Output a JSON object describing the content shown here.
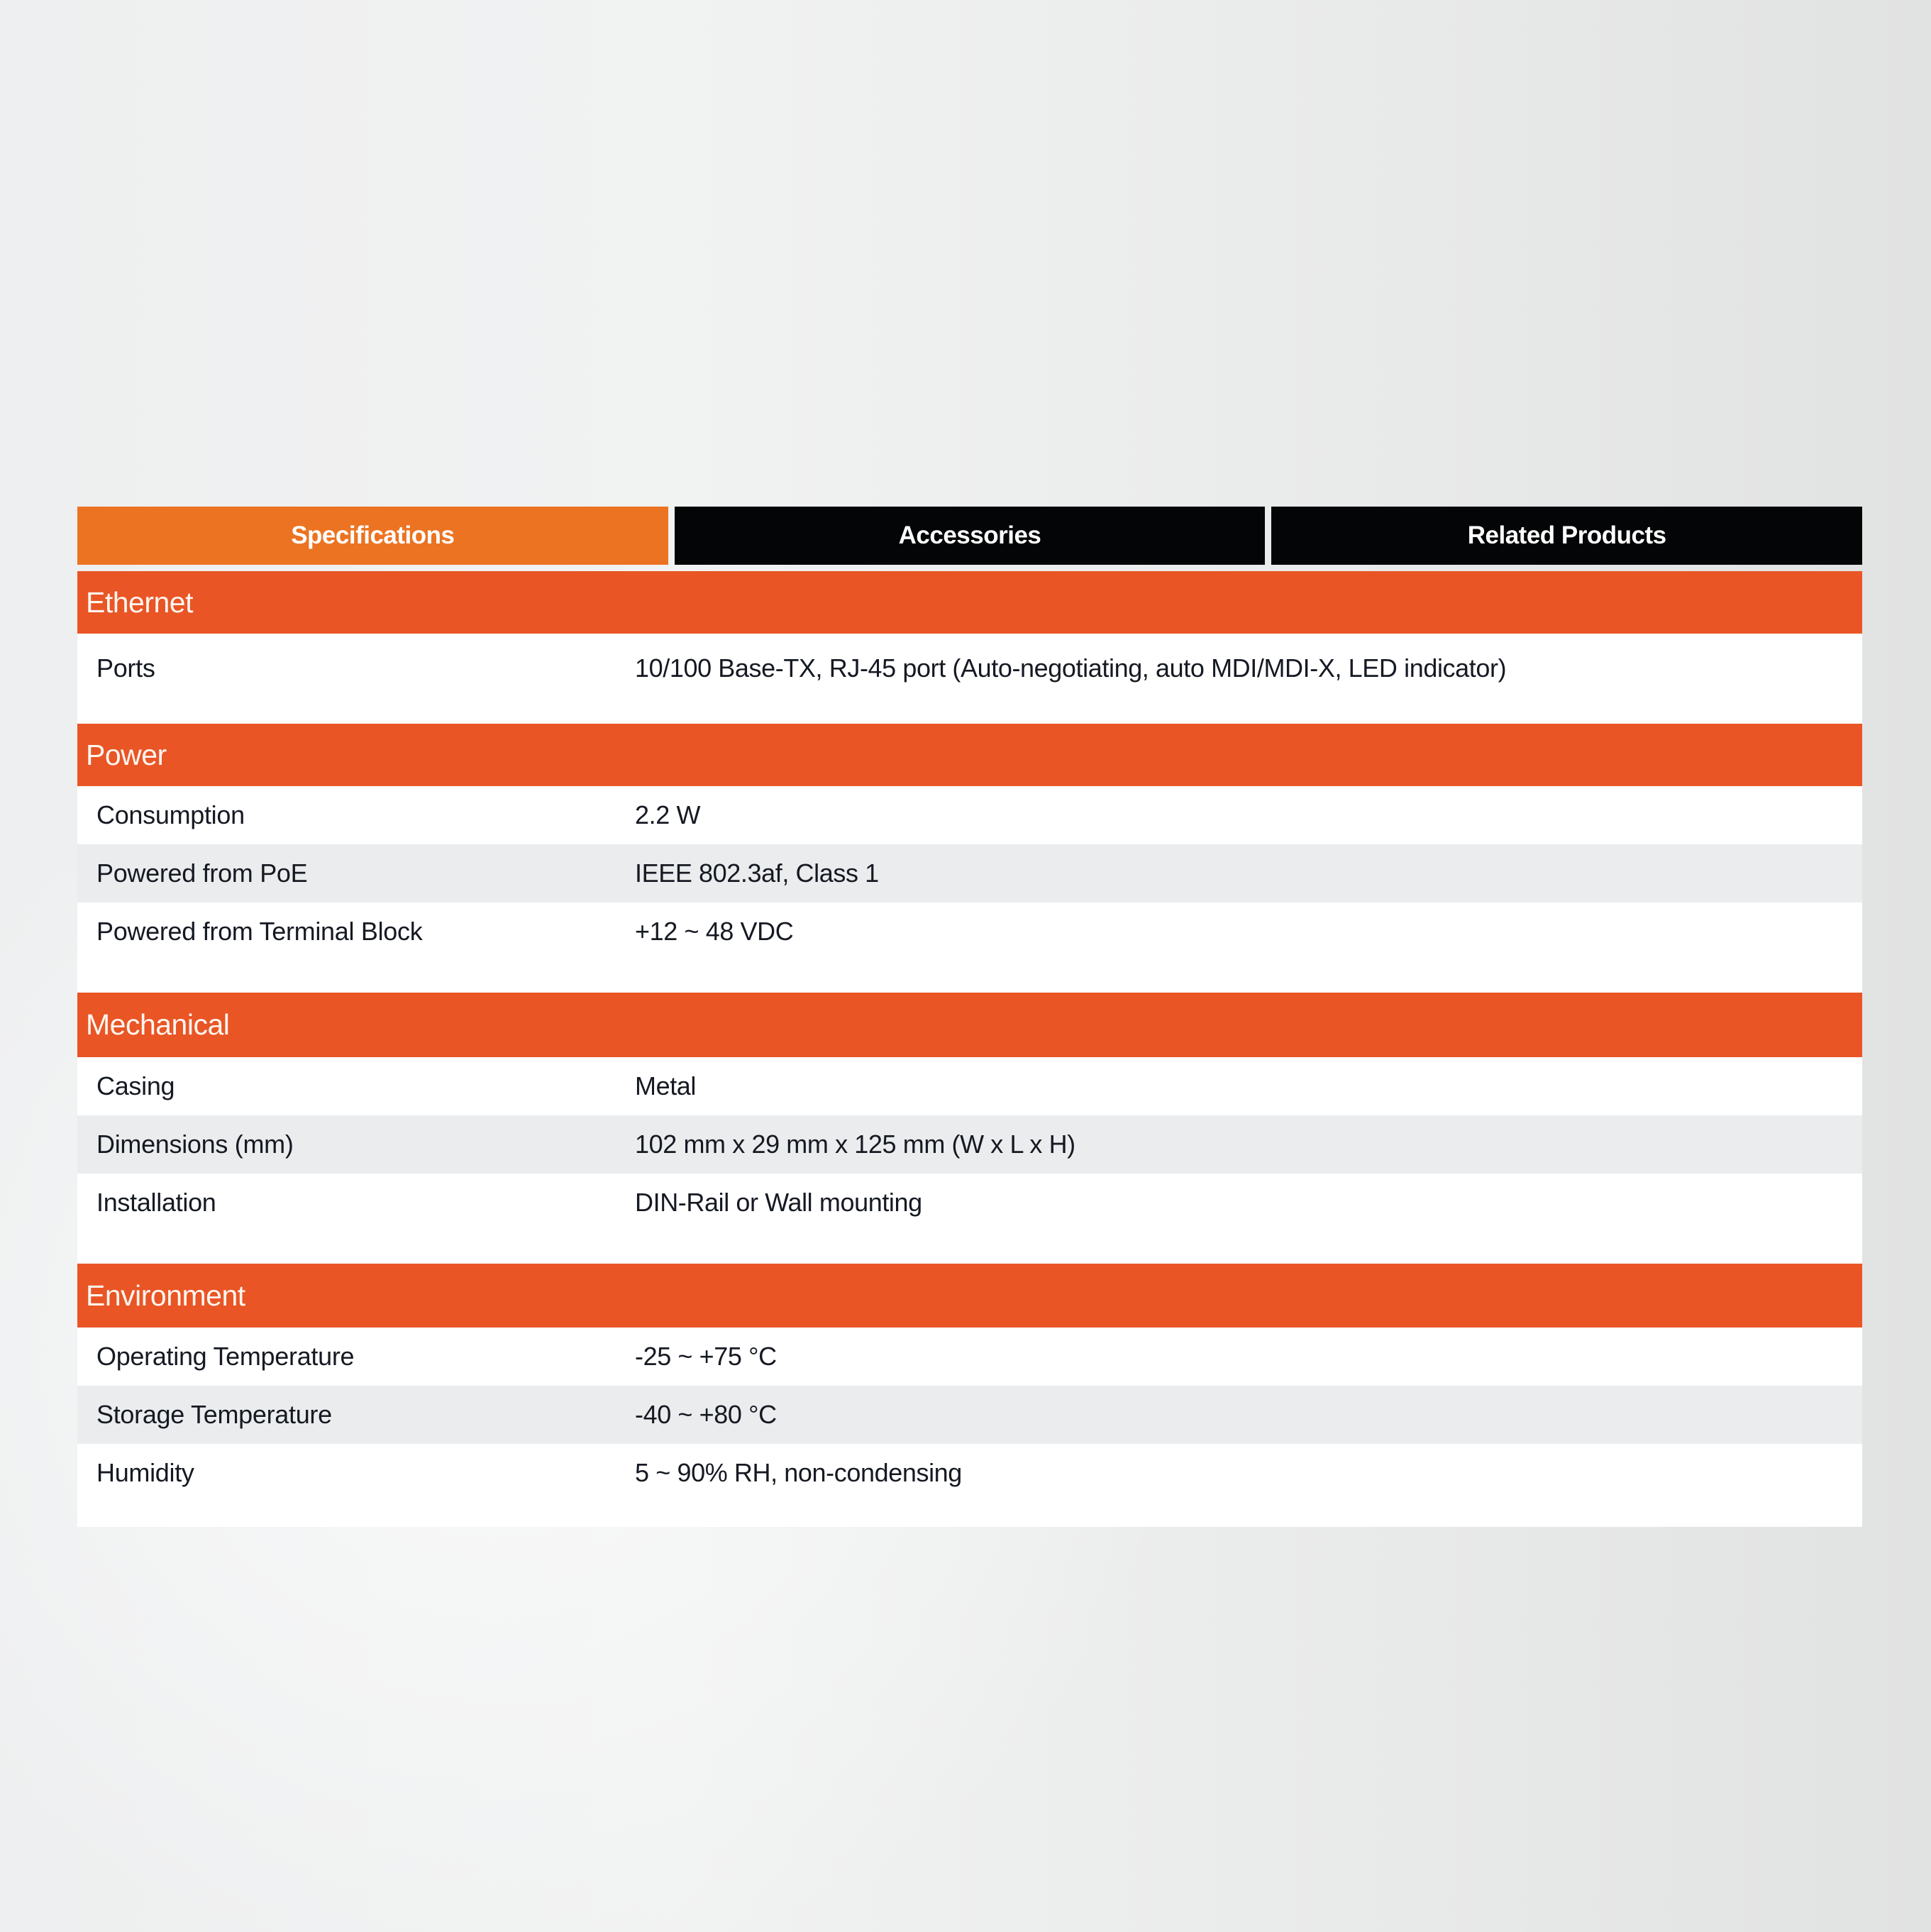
{
  "tabs": [
    {
      "label": "Specifications",
      "active": true
    },
    {
      "label": "Accessories",
      "active": false
    },
    {
      "label": "Related Products",
      "active": false
    }
  ],
  "colors": {
    "active_tab": "#eb7322",
    "inactive_tab": "#030507",
    "section_header": "#e95525",
    "alt_row": "#ebeced"
  },
  "sections": [
    {
      "title": "Ethernet",
      "rows": [
        {
          "label": "Ports",
          "value": "10/100 Base-TX, RJ-45 port (Auto-negotiating, auto MDI/MDI-X, LED indicator)"
        }
      ]
    },
    {
      "title": "Power",
      "rows": [
        {
          "label": "Consumption",
          "value": "2.2 W"
        },
        {
          "label": "Powered from PoE",
          "value": "IEEE 802.3af, Class 1"
        },
        {
          "label": "Powered from Terminal Block",
          "value": "+12 ~ 48 VDC"
        }
      ]
    },
    {
      "title": "Mechanical",
      "rows": [
        {
          "label": "Casing",
          "value": "Metal"
        },
        {
          "label": "Dimensions (mm)",
          "value": "102 mm x 29 mm x 125 mm (W x L x H)"
        },
        {
          "label": "Installation",
          "value": "DIN-Rail or Wall mounting"
        }
      ]
    },
    {
      "title": "Environment",
      "rows": [
        {
          "label": "Operating Temperature",
          "value": "-25 ~ +75 °C"
        },
        {
          "label": "Storage Temperature",
          "value": "-40 ~ +80 °C"
        },
        {
          "label": "Humidity",
          "value": "5 ~ 90% RH, non-condensing"
        }
      ]
    }
  ]
}
